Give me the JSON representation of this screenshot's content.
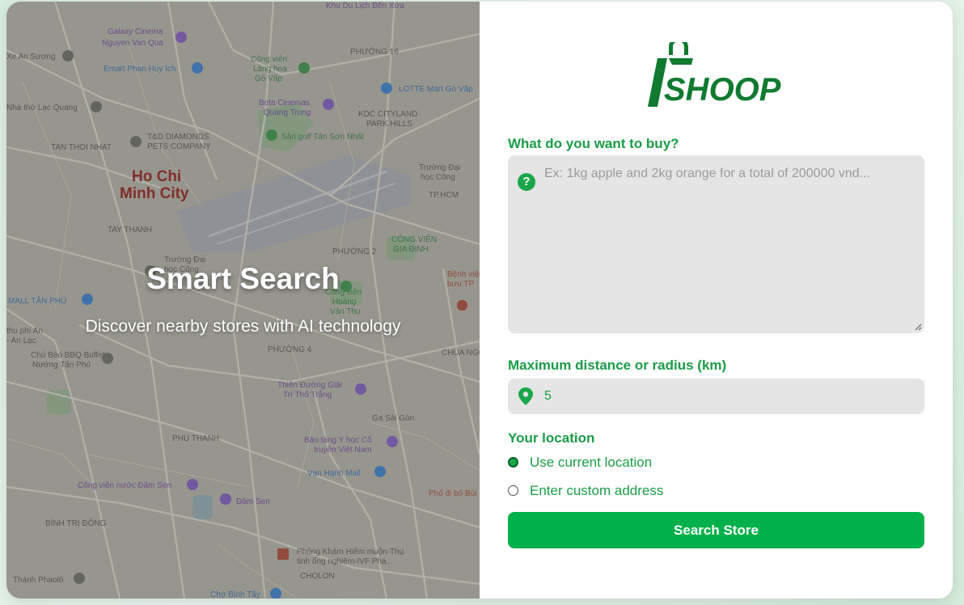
{
  "hero": {
    "title": "Smart Search",
    "subtitle": "Discover nearby stores with AI technology"
  },
  "map": {
    "labels": {
      "city": [
        "Ho Chi",
        "Minh City"
      ],
      "galaxy": [
        "Galaxy Cinema",
        "Nguyen Van Qua"
      ],
      "emart": "Emart Phan Huy Ich",
      "lang_hoa": [
        "Công viên",
        "Làng hoa",
        "Gò Vấp"
      ],
      "beta": [
        "Beta Cinemas",
        "Quang Trung"
      ],
      "lotte": "LOTTE Mart Gò Vấp",
      "kdc": [
        "KDC CITYLAND",
        "PARK HILLS"
      ],
      "golf": "Sân golf Tân Sơn Nhất",
      "td": [
        "T&D DIAMONDS",
        "PETS COMPANY"
      ],
      "tan_thoi_nhat": "TAN THOI NHAT",
      "tay_thanh": "TAY THANH",
      "phuong2": "PHƯỜNG 2",
      "phuong4": "PHƯỜNG 4",
      "gia_dinh": [
        "CÔNG VIÊN",
        "GIA ĐỊNH"
      ],
      "truong_dai_hoc": [
        "Trường Đại",
        "học Công"
      ],
      "hoang_van_thu": [
        "Công viên",
        "Hoàng",
        "Văn Thụ"
      ],
      "aeon": "MALL TÂN PHÚ",
      "chu_bbq": [
        "Chú Béo BBQ Buffet",
        "Nướng Tân Phú"
      ],
      "thien_duong": [
        "Thiên Đường Giải",
        "Trí Thố Trắng"
      ],
      "ga_sai_gon": "Ga Sài Gòn",
      "bao_tang": [
        "Bảo tàng Y học Cổ",
        "truyền Việt Nam"
      ],
      "van_hanh": "Vạn Hạnh Mall",
      "dam_sen_park": "Công viên nước Đầm Sen",
      "dam_sen": "Đầm Sen",
      "phu_thanh": "PHU THANH",
      "binh_tri_dong": "BÌNH TRỊ ĐÔNG",
      "phong_kham": [
        "Phòng Khám Hiếm muộn-Thụ",
        "tinh ống nghiệm-IVF Pha..."
      ],
      "cholon": "CHOLON",
      "cho_binh_tay": "Chợ Bình Tây",
      "thanh_phao": "Thánh Phaolô",
      "nha_tho": "Nhà thờ Lạc Quang",
      "an_suong": "Xe An Sương",
      "khu_du_lich": "Khu Du Lịch Bến Xưa",
      "phuong16": "PHƯỜNG 16",
      "truong_dai_hoc2": [
        "Trường Đại",
        "học Công",
        "TP.HCM"
      ],
      "benh_vien": [
        "Bệnh viện",
        "bưu TP"
      ],
      "chua_ngoc": "CHÙA NGỌC",
      "pho_di_bo": "Phố đi bộ Bùi",
      "thu_phi_an": [
        "thu phí An",
        "- An Lạc"
      ]
    }
  },
  "logo": {
    "text": "SHOOP"
  },
  "form": {
    "buy_label": "What do you want to buy?",
    "buy_placeholder": "Ex: 1kg apple and 2kg orange for a total of 200000 vnd...",
    "distance_label": "Maximum distance or radius (km)",
    "distance_value": "5",
    "location_label": "Your location",
    "location_options": [
      {
        "label": "Use current location",
        "checked": true
      },
      {
        "label": "Enter custom address",
        "checked": false
      }
    ],
    "submit_label": "Search Store"
  },
  "colors": {
    "accent": "#1a9c45",
    "button": "#00b04a",
    "input_bg": "#e5e5e5",
    "logo": "#0f7a30"
  }
}
